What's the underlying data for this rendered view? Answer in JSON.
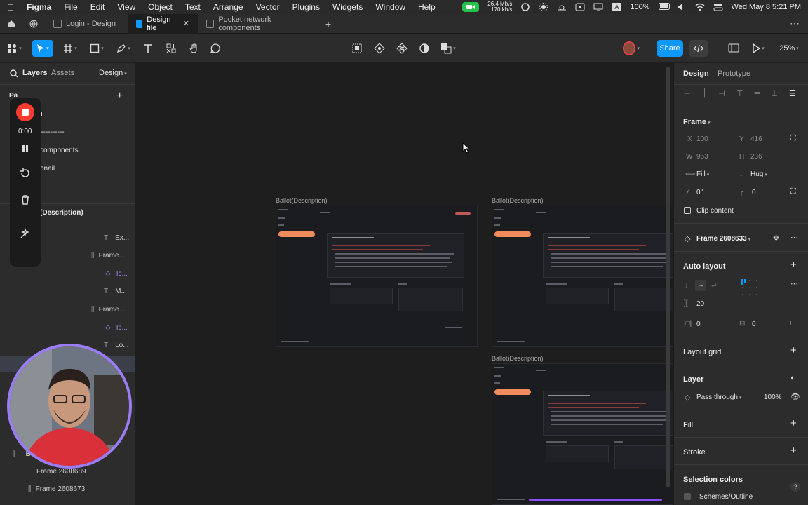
{
  "menubar": {
    "app": "Figma",
    "items": [
      "File",
      "Edit",
      "View",
      "Object",
      "Text",
      "Arrange",
      "Vector",
      "Plugins",
      "Widgets",
      "Window",
      "Help"
    ],
    "net_up": "26.4 Mb/s",
    "net_down": "170 kb/s",
    "battery": "100%",
    "datetime": "Wed May 8  5:21 PM"
  },
  "tabs": [
    {
      "label": "Login - Design"
    },
    {
      "label": "Design file"
    },
    {
      "label": "Pocket network components"
    }
  ],
  "toolbar": {
    "share_label": "Share",
    "zoom": "25%"
  },
  "left": {
    "tab_layers": "Layers",
    "tab_assets": "Assets",
    "tab_design": "Design",
    "pages_label": "Pa",
    "rec_time": "0:00",
    "pages": [
      "n",
      "-----------",
      "components",
      "onail"
    ],
    "section_title": "(Description)",
    "layers": [
      "Ex...",
      "Frame ...",
      "Ic...",
      "M...",
      "Frame ...",
      "Ic...",
      "Lo..."
    ],
    "bottom_layers": [
      "Ballo",
      "Frame 2608689",
      "Frame 2608673"
    ]
  },
  "canvas": {
    "frame_labels": [
      "Ballot(Description)",
      "Ballot(Description)",
      "Ballot(Description)"
    ]
  },
  "right": {
    "tab_design": "Design",
    "tab_prototype": "Prototype",
    "frame_label": "Frame",
    "x_label": "X",
    "x_value": "100",
    "y_label": "Y",
    "y_value": "416",
    "w_label": "W",
    "w_value": "953",
    "h_label": "H",
    "h_value": "236",
    "fill_mode": "Fill",
    "hug_mode": "Hug",
    "rotation": "0°",
    "radius": "0",
    "clip_content": "Clip content",
    "component_name": "Frame 2608633",
    "auto_layout": "Auto layout",
    "gap": "20",
    "padding_h": "0",
    "padding_v": "0",
    "layout_grid": "Layout grid",
    "layer": "Layer",
    "blend_mode": "Pass through",
    "opacity": "100%",
    "fill": "Fill",
    "stroke": "Stroke",
    "selection_colors": "Selection colors",
    "color_style": "Schemes/Outline"
  },
  "colors": {
    "accent": "#0d99ff",
    "record": "#ff3b30",
    "orange": "#f08b5c"
  }
}
